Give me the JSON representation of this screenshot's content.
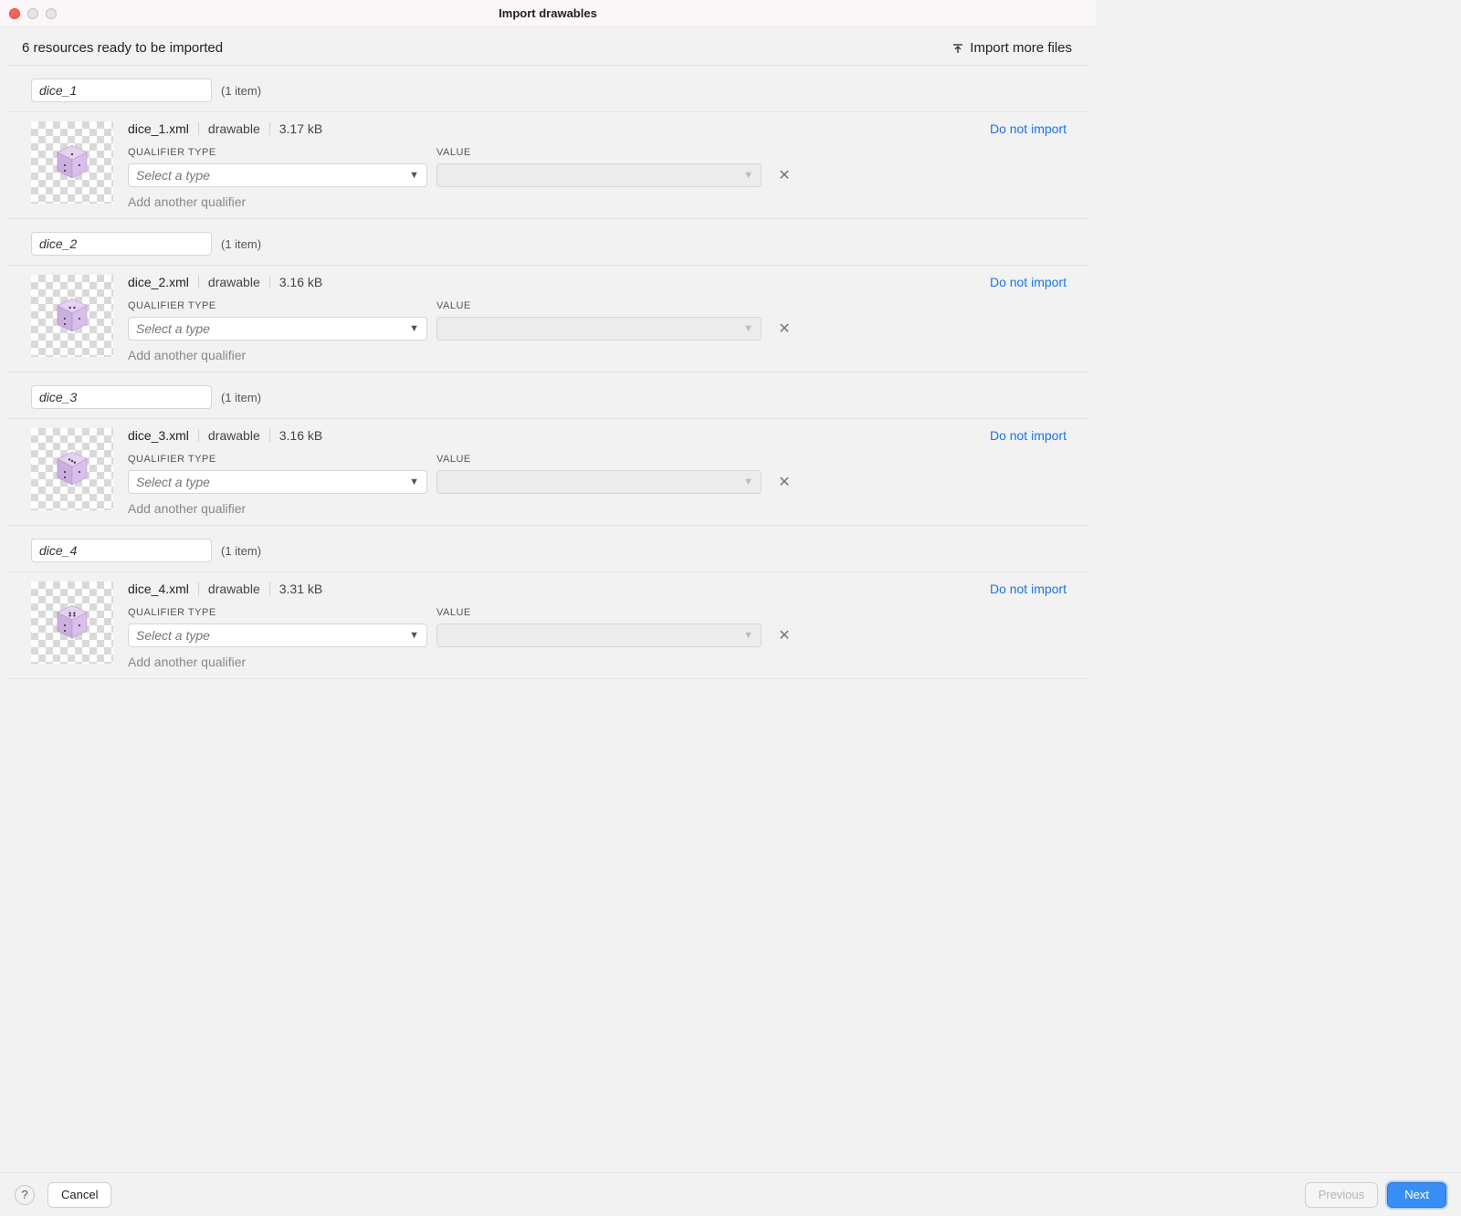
{
  "window": {
    "title": "Import drawables"
  },
  "status": {
    "summary": "6 resources ready to be imported",
    "import_more_label": "Import more files"
  },
  "labels": {
    "qualifier_type": "QUALIFIER TYPE",
    "value": "VALUE",
    "select_placeholder": "Select a type",
    "add_qualifier": "Add another qualifier",
    "do_not_import": "Do not import",
    "item_count": "(1 item)"
  },
  "footer": {
    "cancel": "Cancel",
    "previous": "Previous",
    "next": "Next"
  },
  "resources": [
    {
      "name": "dice_1",
      "filename": "dice_1.xml",
      "type": "drawable",
      "size": "3.17 kB",
      "dots": [
        [
          0.5,
          0.5
        ]
      ]
    },
    {
      "name": "dice_2",
      "filename": "dice_2.xml",
      "type": "drawable",
      "size": "3.16 kB",
      "dots": [
        [
          0.33,
          0.5
        ],
        [
          0.67,
          0.5
        ]
      ]
    },
    {
      "name": "dice_3",
      "filename": "dice_3.xml",
      "type": "drawable",
      "size": "3.16 kB",
      "dots": [
        [
          0.3,
          0.3
        ],
        [
          0.5,
          0.5
        ],
        [
          0.7,
          0.7
        ]
      ]
    },
    {
      "name": "dice_4",
      "filename": "dice_4.xml",
      "type": "drawable",
      "size": "3.31 kB",
      "dots": [
        [
          0.33,
          0.33
        ],
        [
          0.67,
          0.33
        ],
        [
          0.33,
          0.67
        ],
        [
          0.67,
          0.67
        ]
      ]
    }
  ]
}
